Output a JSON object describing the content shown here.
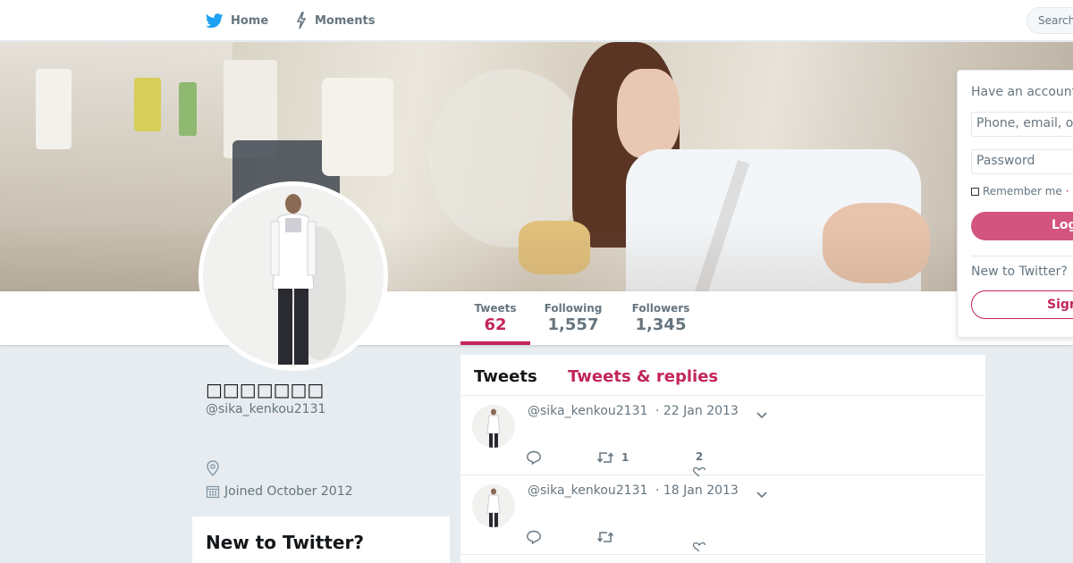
{
  "nav": {
    "home_label": "Home",
    "moments_label": "Moments",
    "search_placeholder": "Search"
  },
  "colors": {
    "accent": "#c2255c",
    "brand_blue": "#1da1f2",
    "login_button": "#d3557f",
    "muted_text": "#66757f"
  },
  "profile": {
    "name": "□□□□□□□",
    "handle": "@sika_kenkou2131",
    "joined": "Joined October 2012"
  },
  "stats": [
    {
      "label": "Tweets",
      "value": "62"
    },
    {
      "label": "Following",
      "value": "1,557"
    },
    {
      "label": "Followers",
      "value": "1,345"
    }
  ],
  "timeline": {
    "tabs": [
      "Tweets",
      "Tweets & replies"
    ],
    "tweets": [
      {
        "user": "@sika_kenkou2131",
        "date": "· 22 Jan 2013",
        "retweets": "1",
        "likes": "2"
      },
      {
        "user": "@sika_kenkou2131",
        "date": "· 18 Jan 2013",
        "retweets": "",
        "likes": ""
      }
    ]
  },
  "new_to_twitter_card": {
    "title": "New to Twitter?"
  },
  "login": {
    "title": "Have an account?",
    "username_placeholder": "Phone, email, or username",
    "password_placeholder": "Password",
    "remember_label": "Remember me",
    "remember_separator": "·",
    "login_button": "Log in",
    "new_label": "New to Twitter?",
    "signup_button": "Sign up"
  }
}
